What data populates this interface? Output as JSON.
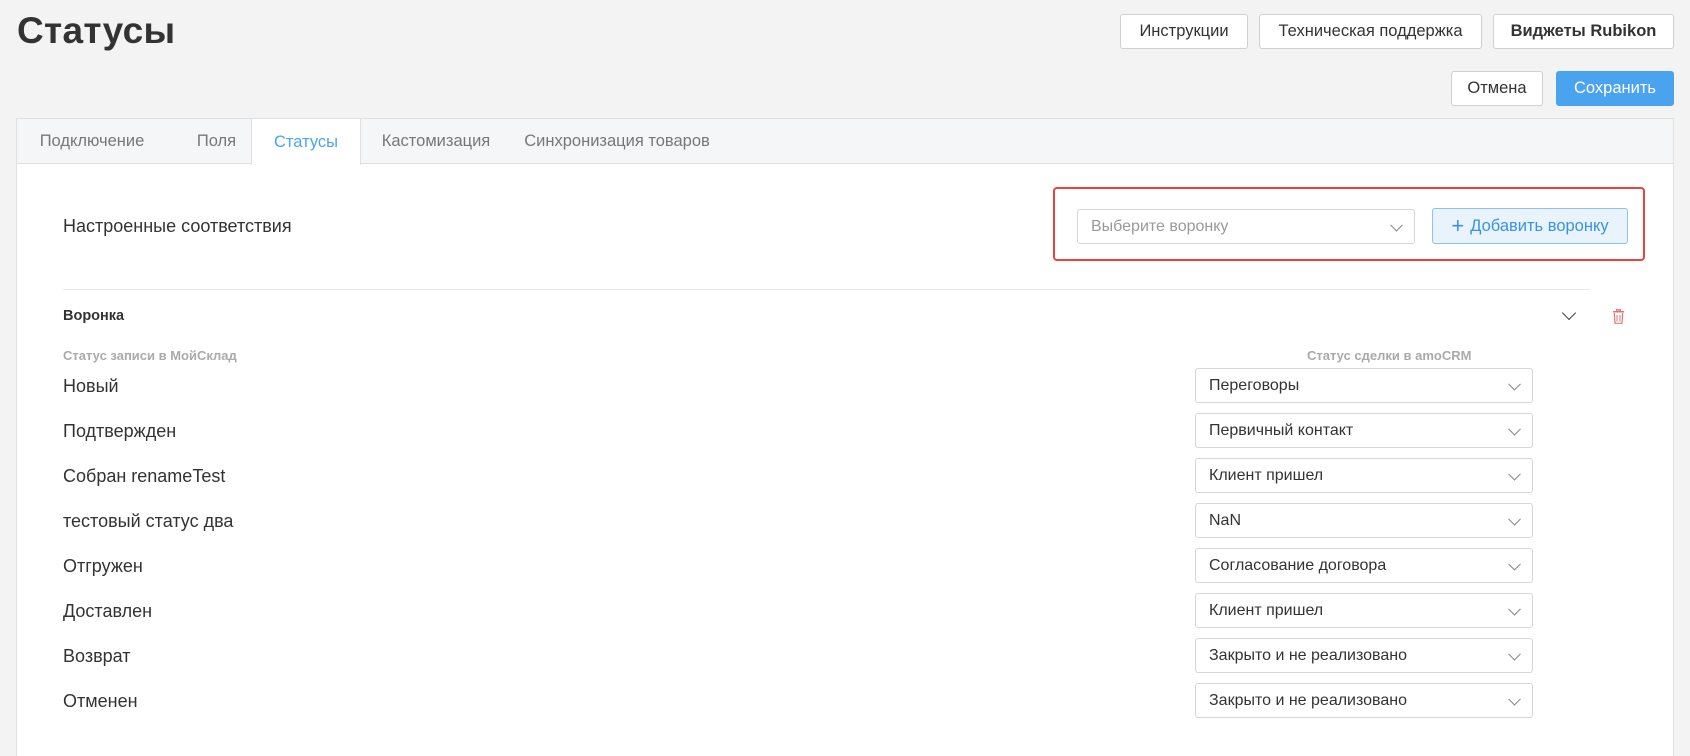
{
  "page": {
    "title": "Статусы"
  },
  "header": {
    "instructions": "Инструкции",
    "support": "Техническая поддержка",
    "widgets": "Виджеты Rubikon",
    "cancel": "Отмена",
    "save": "Сохранить"
  },
  "tabs": [
    {
      "label": "Подключение"
    },
    {
      "label": "Поля"
    },
    {
      "label": "Статусы",
      "active": true
    },
    {
      "label": "Кастомизация"
    },
    {
      "label": "Синхронизация товаров"
    }
  ],
  "mapping": {
    "label": "Настроенные соответствия",
    "funnel_placeholder": "Выберите воронку",
    "add_funnel": "Добавить воронку"
  },
  "funnel": {
    "title": "Воронка",
    "col_left": "Статус записи в МойСклад",
    "col_right": "Статус сделки в amoCRM",
    "rows": [
      {
        "status": "Новый",
        "deal": "Переговоры"
      },
      {
        "status": "Подтвержден",
        "deal": "Первичный контакт"
      },
      {
        "status": "Собран renameTest",
        "deal": "Клиент пришел"
      },
      {
        "status": "тестовый статус два",
        "deal": "NaN"
      },
      {
        "status": "Отгружен",
        "deal": "Согласование договора"
      },
      {
        "status": "Доставлен",
        "deal": "Клиент пришел"
      },
      {
        "status": "Возврат",
        "deal": "Закрыто и не реализовано"
      },
      {
        "status": "Отменен",
        "deal": "Закрыто и не реализовано"
      }
    ]
  },
  "colors": {
    "accent": "#4aa3ef",
    "highlight": "#e9433f",
    "delete": "#e57373"
  },
  "icons": {
    "add": "plus-icon",
    "dropdown": "chevron-down-icon",
    "delete": "trash-icon"
  }
}
